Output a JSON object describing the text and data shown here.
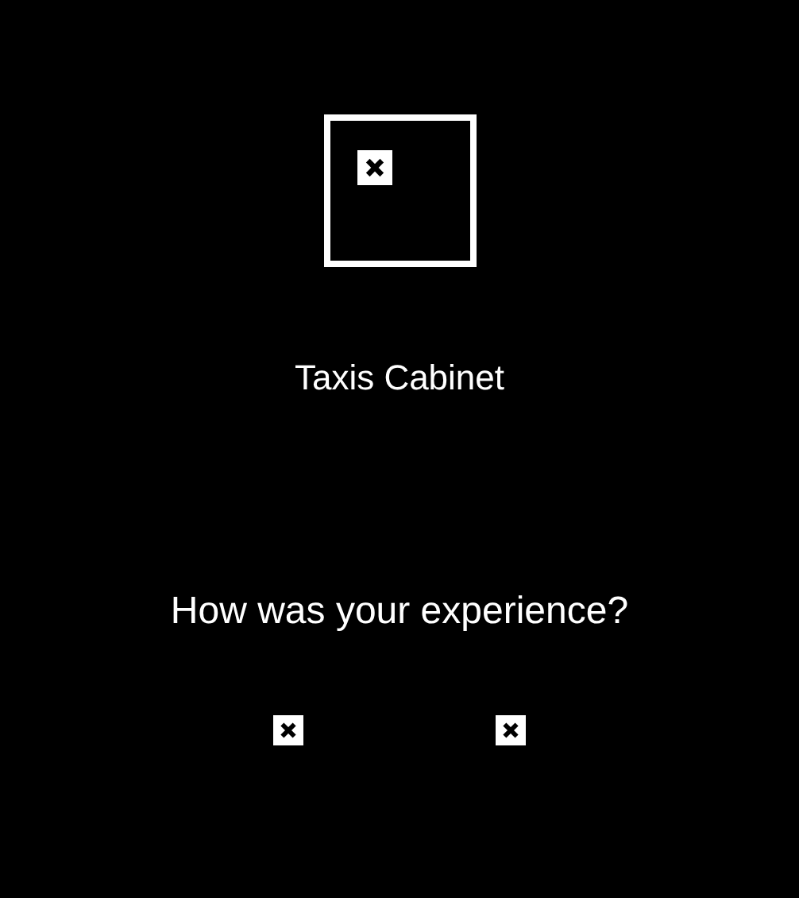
{
  "app_name": "Taxis Cabinet",
  "question": "How was your experience?"
}
